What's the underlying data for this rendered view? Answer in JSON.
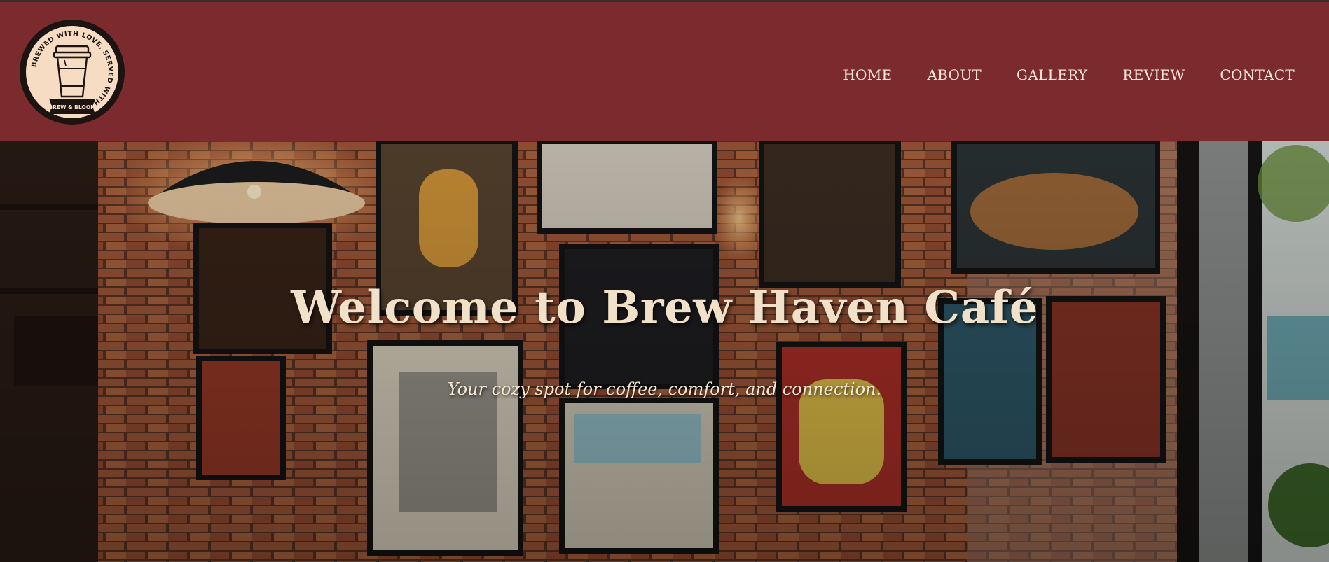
{
  "brand": {
    "logo_ring_text": "BREWED WITH LOVE, SERVED WITH A SMILE",
    "logo_name": "BREW & BLOOM"
  },
  "nav": {
    "items": [
      {
        "label": "HOME"
      },
      {
        "label": "ABOUT"
      },
      {
        "label": "GALLERY"
      },
      {
        "label": "REVIEW"
      },
      {
        "label": "CONTACT"
      }
    ]
  },
  "hero": {
    "title": "Welcome to Brew Haven Café",
    "subtitle": "Your cozy spot for coffee, comfort, and connection."
  },
  "colors": {
    "header_bg": "#7b2a2e",
    "nav_text": "#f6e8d6",
    "hero_title": "#f1e1c9"
  }
}
